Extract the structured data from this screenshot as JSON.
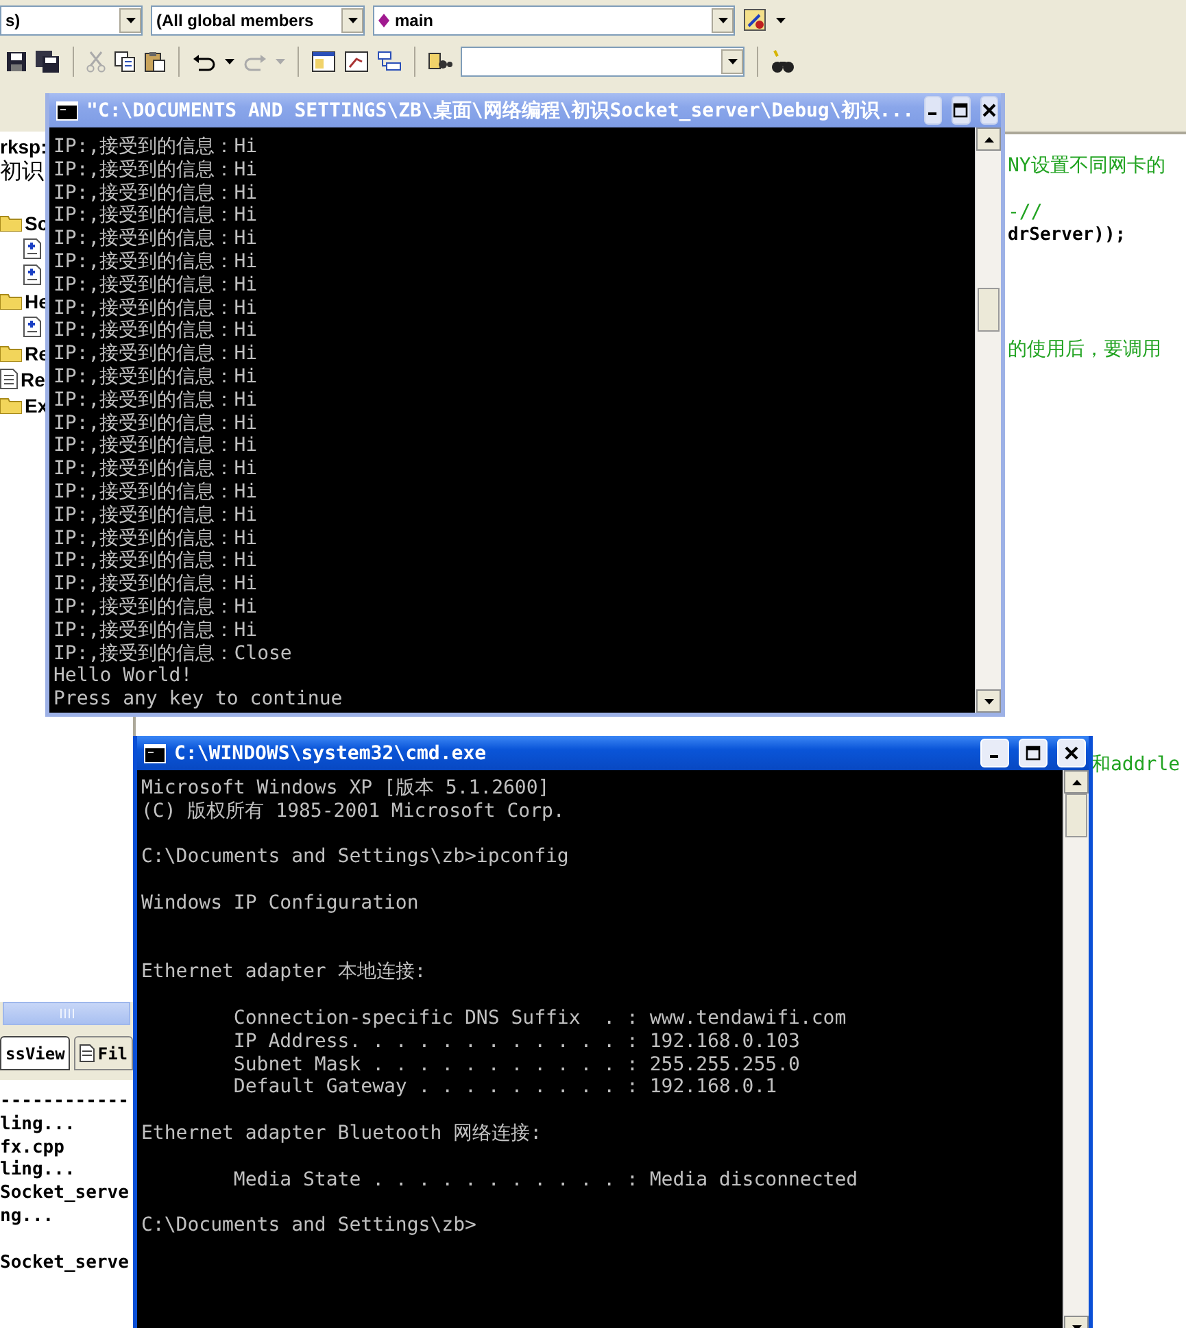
{
  "toolbar": {
    "combos": [
      {
        "text": "s)"
      },
      {
        "text": "(All global members"
      },
      {
        "text": "main"
      }
    ]
  },
  "workspace": {
    "header": "rksp:",
    "project": "初识",
    "tree": [
      {
        "label": "Sc",
        "kind": "folder",
        "children": [
          {
            "kind": "file"
          },
          {
            "kind": "file"
          }
        ]
      },
      {
        "label": "He",
        "kind": "folder",
        "children": [
          {
            "kind": "file"
          }
        ]
      },
      {
        "label": "Re",
        "kind": "folder"
      },
      {
        "label": "Re",
        "kind": "file"
      },
      {
        "label": "Ex",
        "kind": "folder"
      }
    ]
  },
  "panel_tabs": [
    {
      "label": "ssView",
      "selected": true
    },
    {
      "label": "Fil",
      "selected": false
    }
  ],
  "output_lines": [
    {
      "kind": "text",
      "text": "------------"
    },
    {
      "kind": "text",
      "text": "ling..."
    },
    {
      "kind": "text",
      "text": "fx.cpp"
    },
    {
      "kind": "text",
      "text": "ling..."
    },
    {
      "kind": "text",
      "text": "Socket_serve"
    },
    {
      "kind": "text",
      "text": "ng..."
    },
    {
      "kind": "blank"
    },
    {
      "kind": "text",
      "text": "Socket_serve"
    }
  ],
  "editor_lines": [
    {
      "kind": "comment",
      "text": "NY设置不同网卡的"
    },
    {
      "kind": "blank"
    },
    {
      "kind": "comment",
      "text": "-//"
    },
    {
      "kind": "code",
      "text": "drServer));"
    },
    {
      "kind": "blank"
    },
    {
      "kind": "blank"
    },
    {
      "kind": "blank"
    },
    {
      "kind": "blank"
    },
    {
      "kind": "comment",
      "text": "的使用后，要调用"
    },
    {
      "kind": "blank"
    },
    {
      "kind": "blank"
    },
    {
      "kind": "blank"
    },
    {
      "kind": "blank"
    },
    {
      "kind": "blank"
    },
    {
      "kind": "blank"
    },
    {
      "kind": "blank"
    },
    {
      "kind": "blank"
    },
    {
      "kind": "blank"
    },
    {
      "kind": "blank"
    },
    {
      "kind": "blank"
    },
    {
      "kind": "blank"
    },
    {
      "kind": "blank"
    },
    {
      "kind": "blank"
    },
    {
      "kind": "blank"
    },
    {
      "kind": "blank"
    },
    {
      "kind": "blank"
    },
    {
      "kind": "comment",
      "text": "和addrle"
    }
  ],
  "console_window": {
    "title": "\"C:\\DOCUMENTS AND SETTINGS\\ZB\\桌面\\网络编程\\初识Socket_server\\Debug\\初识...",
    "active": false,
    "lines": [
      "IP:,接受到的信息：Hi",
      "IP:,接受到的信息：Hi",
      "IP:,接受到的信息：Hi",
      "IP:,接受到的信息：Hi",
      "IP:,接受到的信息：Hi",
      "IP:,接受到的信息：Hi",
      "IP:,接受到的信息：Hi",
      "IP:,接受到的信息：Hi",
      "IP:,接受到的信息：Hi",
      "IP:,接受到的信息：Hi",
      "IP:,接受到的信息：Hi",
      "IP:,接受到的信息：Hi",
      "IP:,接受到的信息：Hi",
      "IP:,接受到的信息：Hi",
      "IP:,接受到的信息：Hi",
      "IP:,接受到的信息：Hi",
      "IP:,接受到的信息：Hi",
      "IP:,接受到的信息：Hi",
      "IP:,接受到的信息：Hi",
      "IP:,接受到的信息：Hi",
      "IP:,接受到的信息：Hi",
      "IP:,接受到的信息：Hi",
      "IP:,接受到的信息：Close",
      "Hello World!",
      "Press any key to continue"
    ]
  },
  "cmd_window": {
    "title": "C:\\WINDOWS\\system32\\cmd.exe",
    "active": true,
    "lines": [
      {
        "kind": "text",
        "text": "Microsoft Windows XP [版本 5.1.2600]"
      },
      {
        "kind": "text",
        "text": "(C) 版权所有 1985-2001 Microsoft Corp."
      },
      {
        "kind": "blank"
      },
      {
        "kind": "text",
        "text": "C:\\Documents and Settings\\zb>ipconfig"
      },
      {
        "kind": "blank"
      },
      {
        "kind": "text",
        "text": "Windows IP Configuration"
      },
      {
        "kind": "blank"
      },
      {
        "kind": "blank"
      },
      {
        "kind": "text",
        "text": "Ethernet adapter 本地连接:"
      },
      {
        "kind": "blank"
      },
      {
        "kind": "indented",
        "text": "Connection-specific DNS Suffix  . : www.tendawifi.com"
      },
      {
        "kind": "indented",
        "text": "IP Address. . . . . . . . . . . . : 192.168.0.103"
      },
      {
        "kind": "indented",
        "text": "Subnet Mask . . . . . . . . . . . : 255.255.255.0"
      },
      {
        "kind": "indented",
        "text": "Default Gateway . . . . . . . . . : 192.168.0.1"
      },
      {
        "kind": "blank"
      },
      {
        "kind": "text",
        "text": "Ethernet adapter Bluetooth 网络连接:"
      },
      {
        "kind": "blank"
      },
      {
        "kind": "indented",
        "text": "Media State . . . . . . . . . . . : Media disconnected"
      },
      {
        "kind": "blank"
      },
      {
        "kind": "text",
        "text": "C:\\Documents and Settings\\zb>"
      }
    ]
  }
}
